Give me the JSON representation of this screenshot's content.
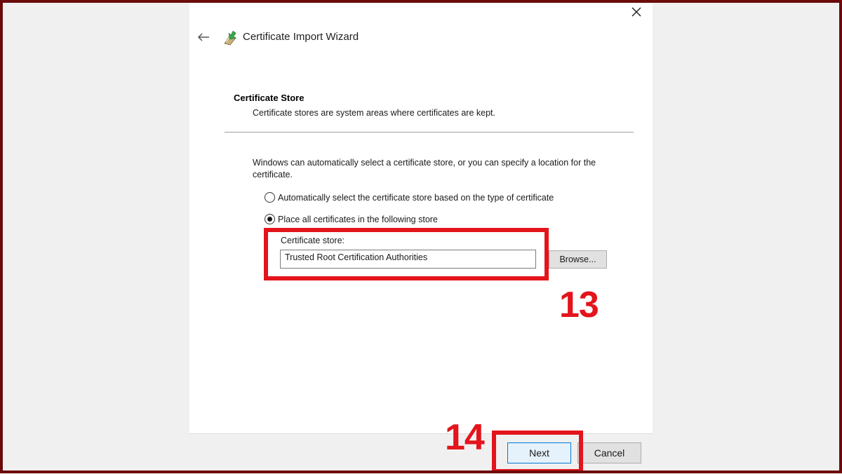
{
  "window": {
    "title": "Certificate Import Wizard",
    "back_icon": "arrow-left-icon",
    "close_icon": "close-icon",
    "wizard_icon": "certificate-wizard-icon"
  },
  "section": {
    "title": "Certificate Store",
    "description": "Certificate stores are system areas where certificates are kept."
  },
  "content": {
    "intro": "Windows can automatically select a certificate store, or you can specify a location for the certificate.",
    "options": [
      {
        "label": "Automatically select the certificate store based on the type of certificate",
        "selected": false
      },
      {
        "label": "Place all certificates in the following store",
        "selected": true
      }
    ],
    "store_label": "Certificate store:",
    "store_value": "Trusted Root Certification Authorities",
    "browse_label": "Browse..."
  },
  "footer": {
    "next_label": "Next",
    "cancel_label": "Cancel"
  },
  "annotations": {
    "step_13": "13",
    "step_14": "14",
    "color": "#e3141b"
  },
  "colors": {
    "accent": "#0078d7",
    "frame": "#6b0b0b"
  }
}
